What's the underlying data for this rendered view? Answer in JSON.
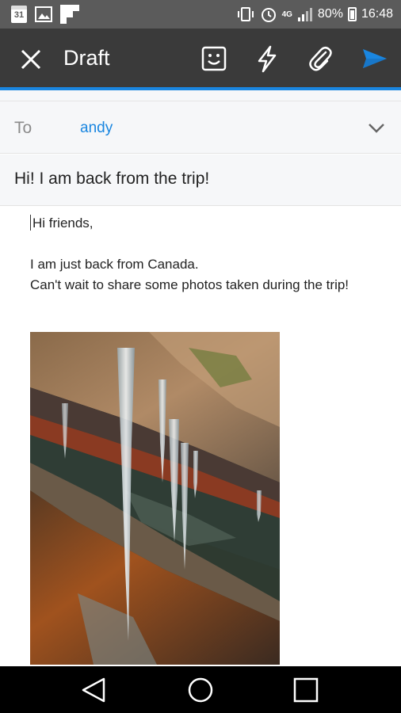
{
  "status_bar": {
    "calendar_day": "31",
    "network": "4G",
    "battery": "80%",
    "time": "16:48",
    "icons": [
      "calendar-icon",
      "image-icon",
      "flipboard-icon",
      "vibrate-icon",
      "alarm-icon",
      "signal-icon",
      "battery-icon"
    ]
  },
  "toolbar": {
    "title": "Draft",
    "icons": [
      "close-icon",
      "emoji-icon",
      "flash-icon",
      "attach-icon",
      "send-icon"
    ],
    "accent_color": "#1a86e0",
    "bg_color": "#3a3a3a"
  },
  "compose": {
    "to_label": "To",
    "to_value": "andy",
    "subject": "Hi! I am back from the trip!",
    "body_lines": [
      "Hi friends,",
      "",
      "I am just back from Canada.",
      "Can't wait to share some photos taken during the trip!"
    ],
    "attachment": "photo of icicles on rocks"
  },
  "nav_bar": {
    "icons": [
      "back-icon",
      "home-icon",
      "recent-apps-icon"
    ]
  }
}
